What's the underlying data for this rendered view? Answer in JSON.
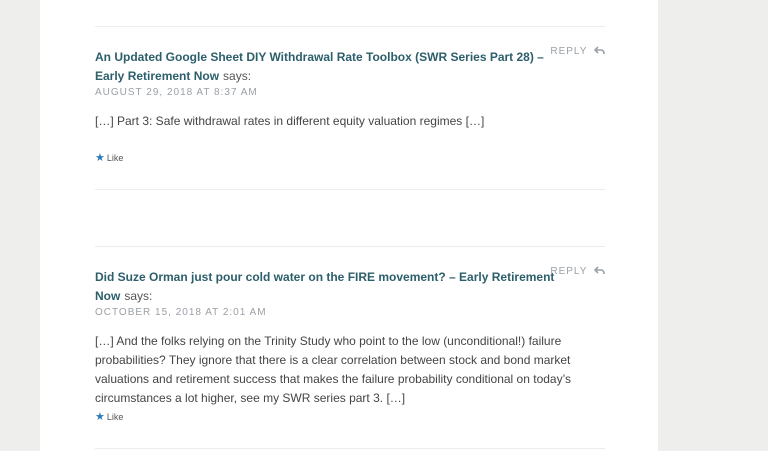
{
  "comments": [
    {
      "author": "An Updated Google Sheet DIY Withdrawal Rate Toolbox (SWR Series Part 28) – Early Retirement Now",
      "says": "says:",
      "date": "AUGUST 29, 2018 AT 8:37 AM",
      "text": "[…] Part 3: Safe withdrawal rates in different equity valuation regimes […]",
      "reply": "REPLY",
      "like": "Like"
    },
    {
      "author": "Did Suze Orman just pour cold water on the FIRE movement? – Early Retirement Now",
      "says": "says:",
      "date": "OCTOBER 15, 2018 AT 2:01 AM",
      "text": "[…] And the folks relying on the Trinity Study who point to the low (unconditional!) failure probabilities? They ignore that there is a clear correlation between stock and bond market valuations and retirement success that makes the failure probability conditional on today’s circumstances a lot higher, see my SWR series part 3. […]",
      "reply": "REPLY",
      "like": "Like"
    }
  ]
}
